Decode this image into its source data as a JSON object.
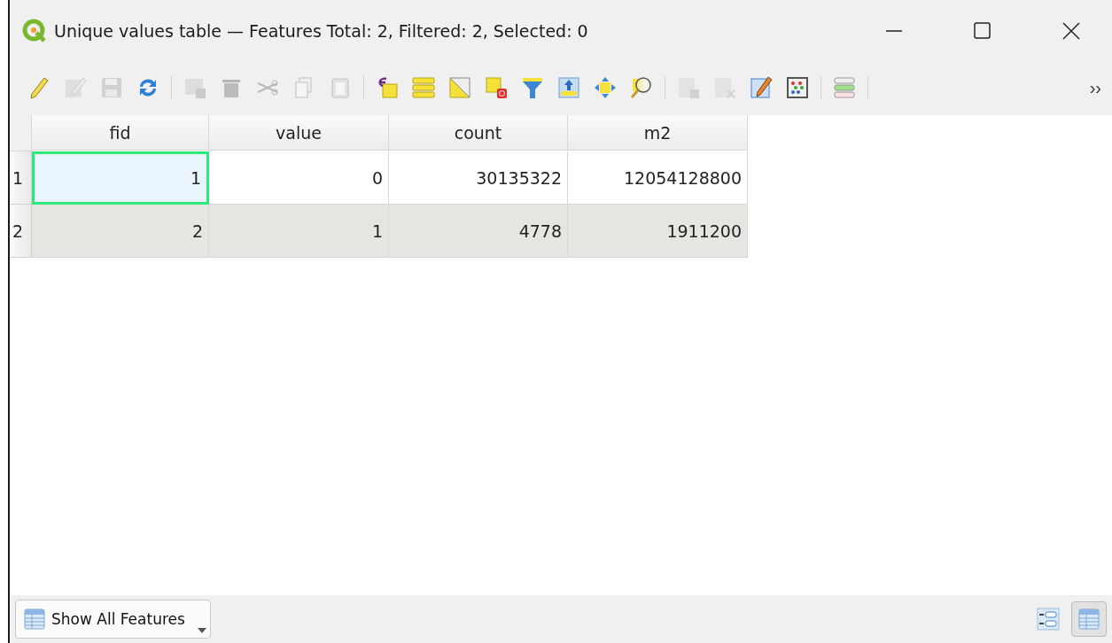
{
  "window": {
    "title": "Unique values table — Features Total: 2, Filtered: 2, Selected: 0"
  },
  "toolbar": {
    "items": [
      {
        "kind": "pencil",
        "disabled": false
      },
      {
        "kind": "multiedit",
        "disabled": true
      },
      {
        "kind": "save",
        "disabled": true
      },
      {
        "kind": "reload",
        "disabled": false
      },
      {
        "kind": "separator"
      },
      {
        "kind": "addrow",
        "disabled": true
      },
      {
        "kind": "trash",
        "disabled": true
      },
      {
        "kind": "cut",
        "disabled": true
      },
      {
        "kind": "copy",
        "disabled": true
      },
      {
        "kind": "paste",
        "disabled": true
      },
      {
        "kind": "separator"
      },
      {
        "kind": "expression",
        "disabled": false
      },
      {
        "kind": "selectall",
        "disabled": false
      },
      {
        "kind": "invert",
        "disabled": false
      },
      {
        "kind": "deselect",
        "disabled": false
      },
      {
        "kind": "filter",
        "disabled": false
      },
      {
        "kind": "movetop",
        "disabled": false
      },
      {
        "kind": "pan",
        "disabled": false
      },
      {
        "kind": "zoom",
        "disabled": false
      },
      {
        "kind": "separator"
      },
      {
        "kind": "newfield",
        "disabled": true
      },
      {
        "kind": "deletefield",
        "disabled": true
      },
      {
        "kind": "calculator",
        "disabled": false
      },
      {
        "kind": "abacus",
        "disabled": false
      },
      {
        "kind": "separator"
      },
      {
        "kind": "layers",
        "disabled": false
      },
      {
        "kind": "separator"
      }
    ],
    "overflow": "››"
  },
  "table": {
    "columns": [
      "fid",
      "value",
      "count",
      "m2"
    ],
    "rows": [
      {
        "header": "1",
        "cells": [
          {
            "value": "1",
            "focused": true
          },
          {
            "value": "0",
            "focused": false
          },
          {
            "value": "30135322",
            "focused": false
          },
          {
            "value": "12054128800",
            "focused": false
          }
        ]
      },
      {
        "header": "2",
        "cells": [
          {
            "value": "2",
            "focused": false
          },
          {
            "value": "1",
            "focused": false
          },
          {
            "value": "4778",
            "focused": false
          },
          {
            "value": "1911200",
            "focused": false
          }
        ]
      }
    ]
  },
  "bottom_bar": {
    "filter_button": "Show All Features",
    "views": [
      {
        "kind": "form",
        "selected": false
      },
      {
        "kind": "table",
        "selected": true
      }
    ]
  }
}
